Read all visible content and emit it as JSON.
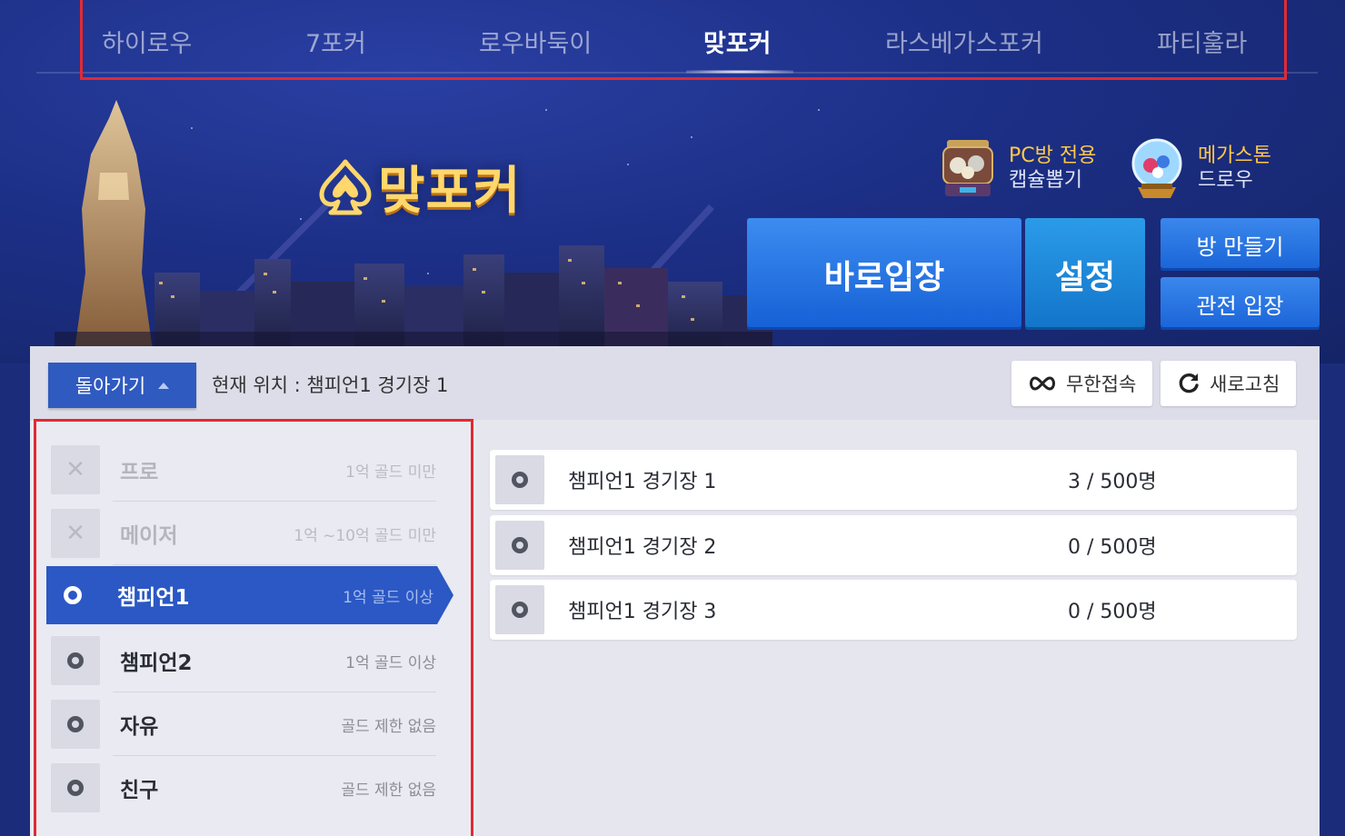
{
  "tabs": [
    {
      "label": "하이로우",
      "active": false
    },
    {
      "label": "7포커",
      "active": false
    },
    {
      "label": "로우바둑이",
      "active": false
    },
    {
      "label": "맞포커",
      "active": true
    },
    {
      "label": "라스베가스포커",
      "active": false
    },
    {
      "label": "파티훌라",
      "active": false
    }
  ],
  "banner": {
    "logo": "맞포커",
    "promo1": {
      "line1": "PC방 전용",
      "line2": "캡슐뽑기",
      "icon": "capsule-machine-icon"
    },
    "promo2": {
      "line1": "메가스톤",
      "line2": "드로우",
      "icon": "crystal-ball-icon"
    },
    "buttons": {
      "quick_enter": "바로입장",
      "settings": "설정",
      "create_room": "방 만들기",
      "watch": "관전 입장"
    }
  },
  "lobby": {
    "back_label": "돌아가기",
    "location": "현재 위치 : 챔피언1 경기장 1",
    "infinite_label": "무한접속",
    "refresh_label": "새로고침",
    "leagues": [
      {
        "name": "프로",
        "desc": "1억 골드 미만",
        "state": "disabled"
      },
      {
        "name": "메이저",
        "desc": "1억 ~10억 골드 미만",
        "state": "disabled"
      },
      {
        "name": "챔피언1",
        "desc": "1억 골드 이상",
        "state": "active"
      },
      {
        "name": "챔피언2",
        "desc": "1억 골드 이상",
        "state": "normal"
      },
      {
        "name": "자유",
        "desc": "골드 제한 없음",
        "state": "normal"
      },
      {
        "name": "친구",
        "desc": "골드 제한 없음",
        "state": "normal"
      }
    ],
    "rooms": [
      {
        "name": "챔피언1 경기장 1",
        "count": "3 / 500명"
      },
      {
        "name": "챔피언1 경기장 2",
        "count": "0 / 500명"
      },
      {
        "name": "챔피언1 경기장 3",
        "count": "0 / 500명"
      }
    ]
  },
  "colors": {
    "accent_blue": "#2b58c4",
    "button_blue": "#1560d6",
    "highlight_red": "#e12a34",
    "gold": "#ffd76a"
  }
}
